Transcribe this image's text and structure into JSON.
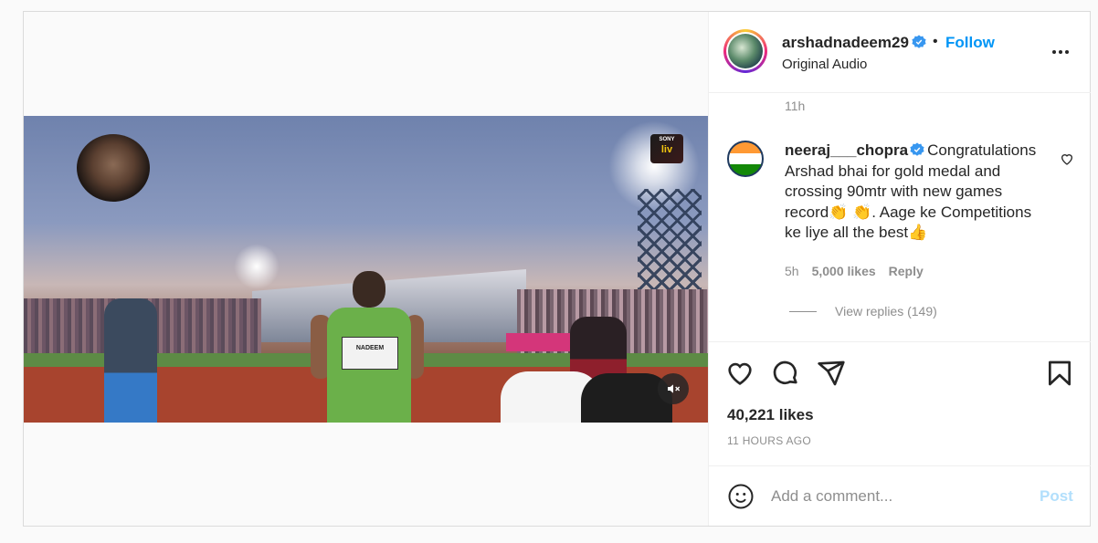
{
  "header": {
    "username": "arshadnadeem29",
    "separator": "•",
    "follow_label": "Follow",
    "audio": "Original Audio"
  },
  "video": {
    "bib_text": "NADEEM",
    "broadcaster_top": "SONY",
    "broadcaster_bottom": "liv"
  },
  "post_time_top": "11h",
  "comment": {
    "username": "neeraj___chopra",
    "text": "Congratulations Arshad bhai for gold medal and crossing 90mtr with new games record👏 👏. Aage ke Competitions ke liye all the best👍",
    "time": "5h",
    "likes": "5,000 likes",
    "reply_label": "Reply",
    "view_replies": "View replies (149)"
  },
  "stats": {
    "likes": "40,221 likes",
    "posted": "11 HOURS AGO"
  },
  "add_comment": {
    "placeholder": "Add a comment...",
    "post_label": "Post"
  },
  "colors": {
    "accent": "#0095f6",
    "post_disabled": "#b2dffc",
    "muted": "#8e8e8e",
    "verified": "#3897f0"
  },
  "icons": [
    "verified-icon",
    "more-icon",
    "heart-icon",
    "comment-icon",
    "share-icon",
    "save-icon",
    "emoji-icon",
    "mute-icon"
  ]
}
